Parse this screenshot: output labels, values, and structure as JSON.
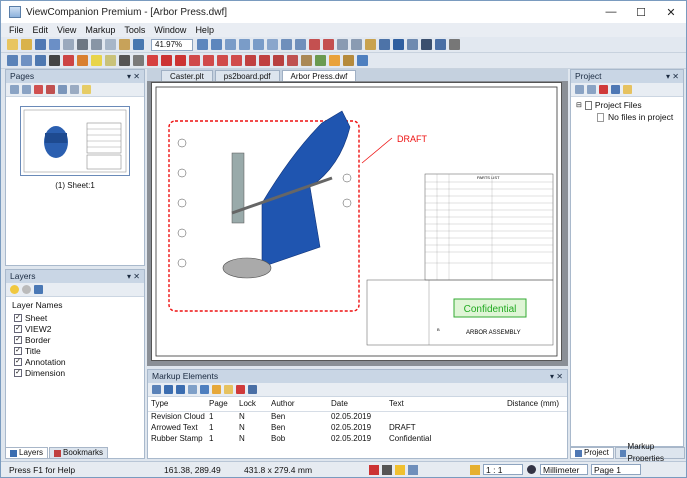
{
  "window": {
    "title": "ViewCompanion Premium - [Arbor Press.dwf]",
    "minimize": "—",
    "maximize": "☐",
    "close": "✕"
  },
  "menu": [
    "File",
    "Edit",
    "View",
    "Markup",
    "Tools",
    "Window",
    "Help"
  ],
  "toolbar": {
    "zoom_value": "41.97%"
  },
  "pages_panel": {
    "title": "Pages",
    "pin": "▾ ✕",
    "thumb_caption": "(1) Sheet:1"
  },
  "layers_panel": {
    "title": "Layers",
    "pin": "▾ ✕",
    "header": "Layer Names",
    "layers": [
      "Sheet",
      "VIEW2",
      "Border",
      "Title",
      "Annotation",
      "Dimension"
    ]
  },
  "left_tabs": {
    "layers": "Layers",
    "bookmarks": "Bookmarks"
  },
  "doc_tabs": [
    "Caster.plt",
    "ps2board.pdf",
    "Arbor Press.dwf"
  ],
  "drawing": {
    "draft": "DRAFT",
    "confidential": "Confidential",
    "assembly": "ARBOR ASSEMBLY",
    "parts_title": "PARTS LIST",
    "size": "B"
  },
  "markup_panel": {
    "title": "Markup Elements",
    "pin": "▾ ✕",
    "columns": [
      "Type",
      "Page",
      "Lock",
      "Author",
      "Date",
      "Text",
      "Distance (mm)"
    ],
    "rows": [
      [
        "Revision Cloud",
        "1",
        "N",
        "Ben",
        "02.05.2019",
        "",
        ""
      ],
      [
        "Arrowed Text",
        "1",
        "N",
        "Ben",
        "02.05.2019",
        "DRAFT",
        ""
      ],
      [
        "Rubber Stamp",
        "1",
        "N",
        "Bob",
        "02.05.2019",
        "Confidential",
        ""
      ]
    ]
  },
  "project_panel": {
    "title": "Project",
    "pin": "▾ ✕",
    "root": "Project Files",
    "empty": "No files in project"
  },
  "right_tabs": {
    "project": "Project",
    "markup_props": "Markup Properties"
  },
  "status": {
    "help": "Press F1 for Help",
    "coords": "161.38, 289.49",
    "size": "431.8 x 279.4 mm",
    "scale": "1 : 1",
    "unit": "Millimeter",
    "page": "Page 1"
  }
}
